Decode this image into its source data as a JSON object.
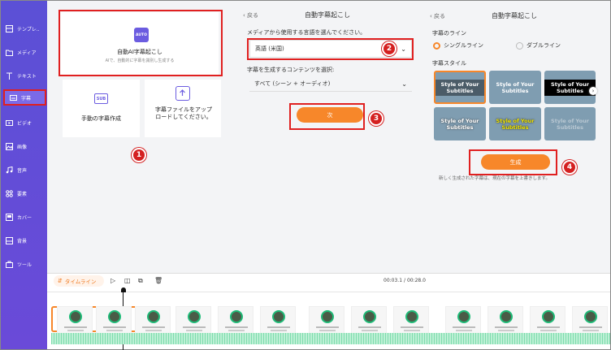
{
  "sidebar": {
    "items": [
      {
        "label": "テンプレ..",
        "icon": "template-icon"
      },
      {
        "label": "メディア",
        "icon": "folder-icon"
      },
      {
        "label": "テキスト",
        "icon": "text-icon"
      },
      {
        "label": "字幕",
        "icon": "subtitle-icon"
      },
      {
        "label": "ビデオ",
        "icon": "video-icon"
      },
      {
        "label": "画像",
        "icon": "image-icon"
      },
      {
        "label": "音声",
        "icon": "music-icon"
      },
      {
        "label": "要素",
        "icon": "elements-icon"
      },
      {
        "label": "カバー",
        "icon": "cover-icon"
      },
      {
        "label": "背景",
        "icon": "background-icon"
      },
      {
        "label": "ツール",
        "icon": "tools-icon"
      }
    ]
  },
  "left_panel": {
    "auto_icon_text": "AUTO",
    "auto_title": "自動AI字幕起こし",
    "auto_desc": "AIで、自動的に字幕を識別し生成する",
    "manual_icon_text": "SUB",
    "manual_label": "手動の字幕作成",
    "upload_label": "字幕ファイルをアップロードしてください。"
  },
  "middle_panel": {
    "back": "戻る",
    "title": "自動字幕起こし",
    "lang_label": "メディアから使用する言語を選んでください。",
    "lang_value": "英語 (米国)",
    "content_label": "字幕を生成するコンテンツを選択:",
    "content_value": "すべて (シーン + オーディオ)",
    "next_button": "次"
  },
  "right_panel": {
    "back": "戻る",
    "title": "自動字幕起こし",
    "line_label": "字幕のライン",
    "single_line": "シングルライン",
    "double_line": "ダブルライン",
    "style_label": "字幕スタイル",
    "tile_text": "Style of Your Subtitles",
    "generate_button": "生成",
    "note": "新しく生成された字幕は、現在の字幕を上書きします。"
  },
  "badges": [
    "1",
    "2",
    "3",
    "4"
  ],
  "timeline": {
    "label": "タイムライン",
    "time_current": "00:03.1",
    "time_total": "/ 00:28.0"
  },
  "colors": {
    "accent": "#f7872a",
    "sidebar": "#5b50d6",
    "highlight": "#e02020"
  }
}
